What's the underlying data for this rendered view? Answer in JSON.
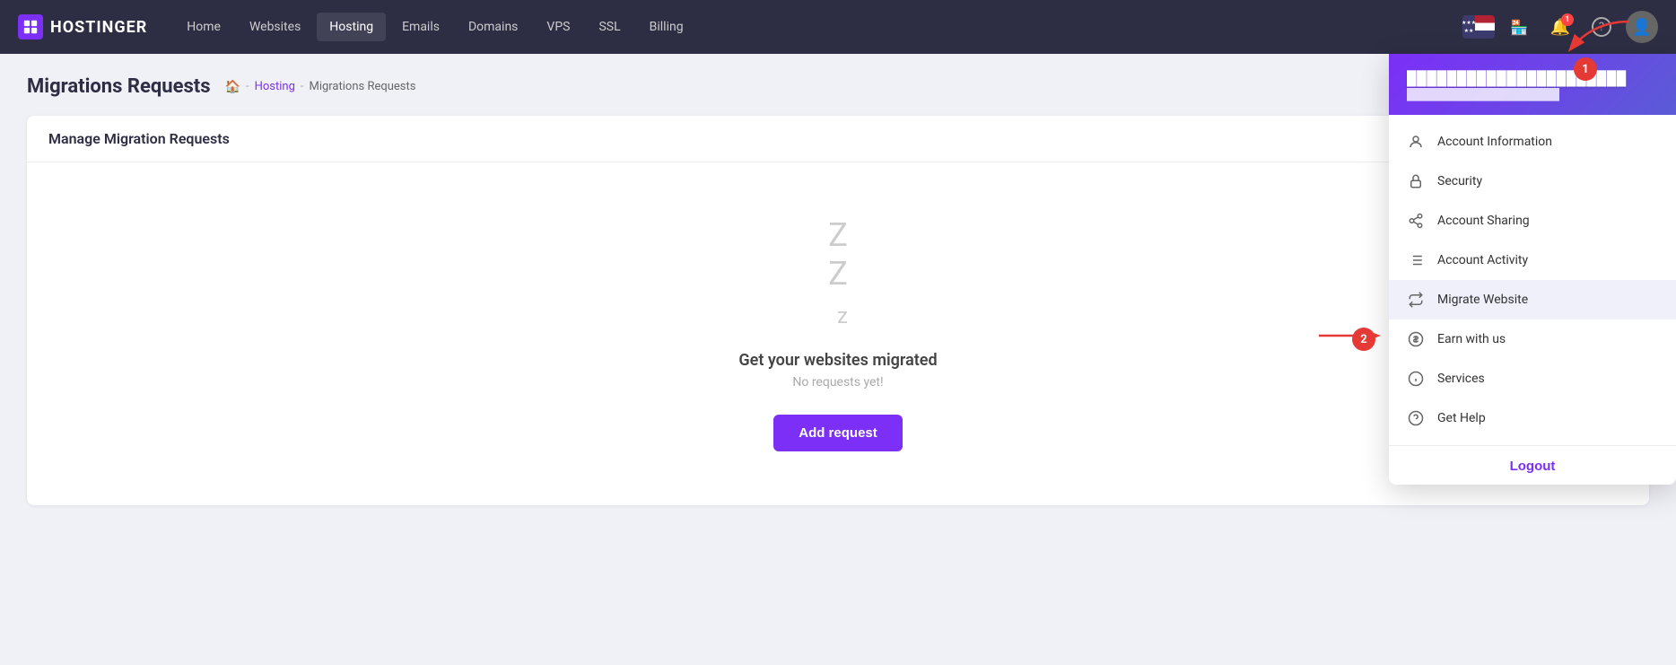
{
  "brand": {
    "name": "HOSTINGER"
  },
  "navbar": {
    "links": [
      {
        "label": "Home",
        "active": false
      },
      {
        "label": "Websites",
        "active": false
      },
      {
        "label": "Hosting",
        "active": true
      },
      {
        "label": "Emails",
        "active": false
      },
      {
        "label": "Domains",
        "active": false
      },
      {
        "label": "VPS",
        "active": false
      },
      {
        "label": "SSL",
        "active": false
      },
      {
        "label": "Billing",
        "active": false
      }
    ]
  },
  "page": {
    "title": "Migrations Requests",
    "breadcrumb": [
      "Hosting",
      "Migrations Requests"
    ],
    "card_title": "Manage Migration Requests",
    "empty_title": "Get your websites migrated",
    "empty_subtitle": "No requests yet!",
    "add_button": "Add request"
  },
  "dropdown": {
    "username": "██████████████████████",
    "email": "████████████████████",
    "menu_items": [
      {
        "label": "Account Information",
        "icon": "person"
      },
      {
        "label": "Security",
        "icon": "lock"
      },
      {
        "label": "Account Sharing",
        "icon": "share"
      },
      {
        "label": "Account Activity",
        "icon": "list"
      },
      {
        "label": "Migrate Website",
        "icon": "swap"
      },
      {
        "label": "Earn with us",
        "icon": "dollar"
      },
      {
        "label": "Services",
        "icon": "info"
      },
      {
        "label": "Get Help",
        "icon": "help"
      }
    ],
    "logout_label": "Logout"
  },
  "annotations": {
    "badge1": "1",
    "badge2": "2"
  }
}
